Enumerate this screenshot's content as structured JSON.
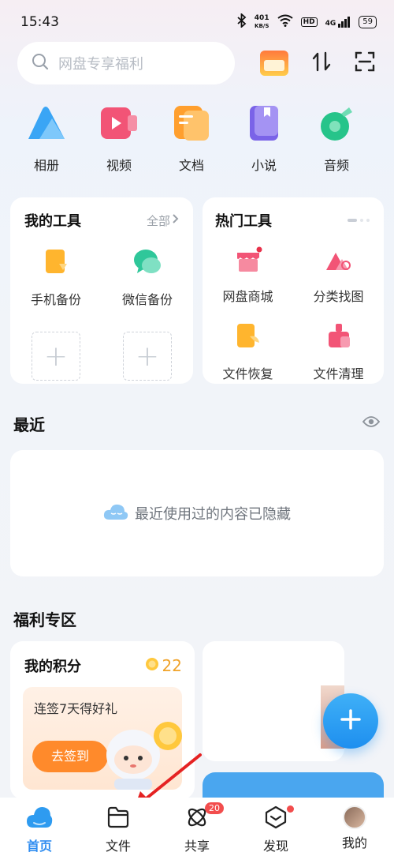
{
  "status": {
    "time": "15:43",
    "speed_value": "401",
    "speed_unit": "KB/S",
    "hd": "HD",
    "network": "4G",
    "battery": "59"
  },
  "search": {
    "placeholder": "网盘专享福利"
  },
  "categories": [
    {
      "label": "相册",
      "icon": "album-icon",
      "color": "#3aa5f5"
    },
    {
      "label": "视频",
      "icon": "video-icon",
      "color": "#f25476"
    },
    {
      "label": "文档",
      "icon": "document-icon",
      "color": "#ff9f2e"
    },
    {
      "label": "小说",
      "icon": "novel-icon",
      "color": "#7a63e8"
    },
    {
      "label": "音频",
      "icon": "audio-icon",
      "color": "#26c48a"
    }
  ],
  "my_tools": {
    "title": "我的工具",
    "all": "全部",
    "items": [
      {
        "label": "手机备份",
        "icon": "phone-backup-icon"
      },
      {
        "label": "微信备份",
        "icon": "wechat-backup-icon"
      }
    ]
  },
  "hot_tools": {
    "title": "热门工具",
    "items": [
      {
        "label": "网盘商城",
        "icon": "mall-store-icon"
      },
      {
        "label": "分类找图",
        "icon": "find-image-icon"
      },
      {
        "label": "文件恢复",
        "icon": "file-restore-icon"
      },
      {
        "label": "文件清理",
        "icon": "file-clean-icon"
      }
    ]
  },
  "recent": {
    "title": "最近",
    "empty_message": "最近使用过的内容已隐藏"
  },
  "welfare": {
    "title": "福利专区",
    "points_title": "我的积分",
    "points_value": "22",
    "sign_text": "连签7天得好礼",
    "sign_button": "去签到"
  },
  "nav": {
    "items": [
      {
        "label": "首页",
        "icon": "home-cloud-icon"
      },
      {
        "label": "文件",
        "icon": "folder-icon"
      },
      {
        "label": "共享",
        "icon": "share-icon",
        "badge": "20"
      },
      {
        "label": "发现",
        "icon": "discover-icon"
      },
      {
        "label": "我的",
        "icon": "avatar"
      }
    ]
  },
  "colors": {
    "accent": "#2e8cf0",
    "sign_button": "#ff8a2b",
    "badge": "#f24d4d"
  }
}
